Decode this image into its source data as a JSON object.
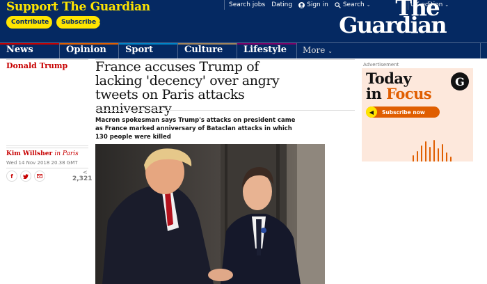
{
  "header": {
    "support_text": "Support The Guardian",
    "contribute_label": "Contribute",
    "subscribe_label": "Subscribe",
    "search_jobs": "Search jobs",
    "dating": "Dating",
    "sign_in": "Sign in",
    "search": "Search",
    "edition": "UK edition",
    "logo_line1": "The",
    "logo_line2": "Guardian",
    "brand_blue": "#052962",
    "brand_yellow": "#ffe500"
  },
  "nav": {
    "items": [
      {
        "label": "News",
        "color": "#c70000"
      },
      {
        "label": "Opinion",
        "color": "#e05e00"
      },
      {
        "label": "Sport",
        "color": "#0084c6"
      },
      {
        "label": "Culture",
        "color": "#a1845c"
      },
      {
        "label": "Lifestyle",
        "color": "#7d0068"
      }
    ],
    "more_label": "More"
  },
  "article": {
    "section": "Donald Trump",
    "headline": "France accuses Trump of lacking 'decency' over angry tweets on Paris attacks anniversary",
    "standfirst": "Macron spokesman says Trump's attacks on president came as France marked anniversary of Bataclan attacks in which 130 people were killed",
    "author": "Kim Willsher",
    "location": "in Paris",
    "date": "Wed 14 Nov 2018 20.38 GMT",
    "share_count": "2,321",
    "accent": "#c70000"
  },
  "ad": {
    "label": "Advertisement",
    "line1": "Today",
    "line2_prefix": "in",
    "line2_focus": "Focus",
    "cta": "Subscribe now"
  }
}
